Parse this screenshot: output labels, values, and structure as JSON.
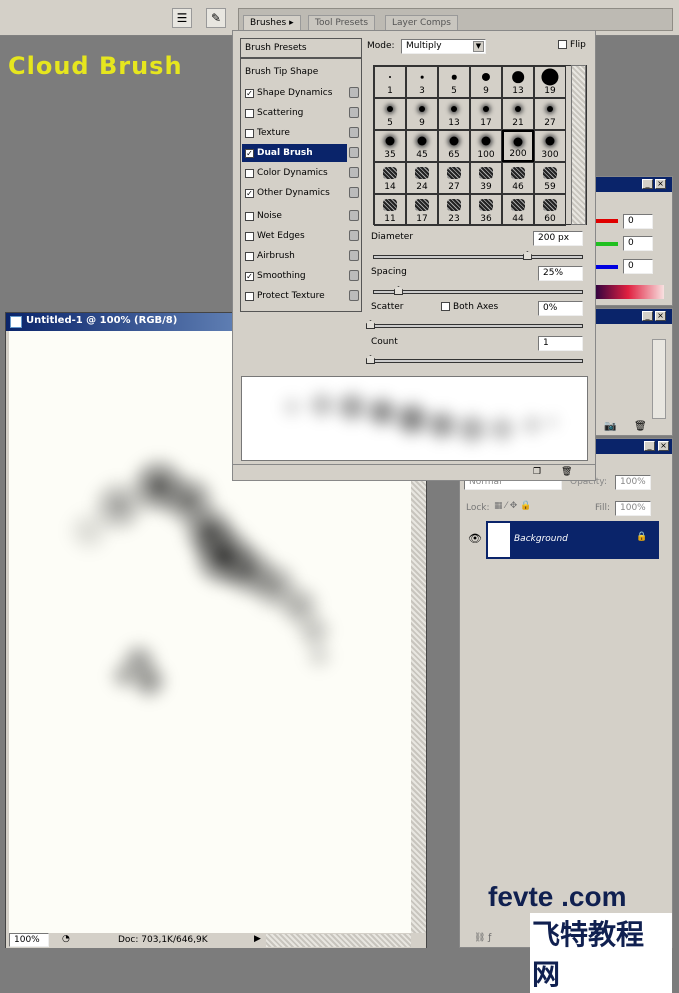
{
  "heading": "Cloud Brush",
  "tabs": [
    {
      "label": "Brushes"
    },
    {
      "label": "Tool Presets"
    },
    {
      "label": "Layer Comps"
    }
  ],
  "brushes": {
    "presets_label": "Brush Presets",
    "tip_shape_label": "Brush Tip Shape",
    "options": [
      {
        "label": "Shape Dynamics",
        "checked": true
      },
      {
        "label": "Scattering",
        "checked": false
      },
      {
        "label": "Texture",
        "checked": false
      },
      {
        "label": "Dual Brush",
        "checked": true,
        "selected": true
      },
      {
        "label": "Color Dynamics",
        "checked": false
      },
      {
        "label": "Other Dynamics",
        "checked": true
      },
      {
        "label": "Noise",
        "checked": false
      },
      {
        "label": "Wet Edges",
        "checked": false
      },
      {
        "label": "Airbrush",
        "checked": false
      },
      {
        "label": "Smoothing",
        "checked": true
      },
      {
        "label": "Protect Texture",
        "checked": false
      }
    ],
    "mode_label": "Mode:",
    "mode_value": "Multiply",
    "flip_label": "Flip",
    "tips": [
      "1",
      "3",
      "5",
      "9",
      "13",
      "19",
      "5",
      "9",
      "13",
      "17",
      "21",
      "27",
      "35",
      "45",
      "65",
      "100",
      "200",
      "300",
      "14",
      "24",
      "27",
      "39",
      "46",
      "59",
      "11",
      "17",
      "23",
      "36",
      "44",
      "60"
    ],
    "selected_tip": "200",
    "diameter_label": "Diameter",
    "diameter_value": "200 px",
    "diameter_pct": 74,
    "spacing_label": "Spacing",
    "spacing_value": "25%",
    "spacing_pct": 12,
    "scatter_label": "Scatter",
    "both_axes_label": "Both Axes",
    "scatter_value": "0%",
    "scatter_pct": 0,
    "count_label": "Count",
    "count_value": "1",
    "count_pct": 0
  },
  "document": {
    "title": "Untitled-1 @ 100% (RGB/8)",
    "zoom": "100%",
    "doc_info": "Doc: 703,1K/646,9K"
  },
  "color_panel": {
    "r": "0",
    "g": "0",
    "b": "0",
    "colors": {
      "r": "#e00000",
      "g": "#20c020",
      "b": "#0000e0"
    }
  },
  "layers": {
    "blend": "Normal",
    "opacity_label": "Opacity:",
    "opacity": "100%",
    "lock_label": "Lock:",
    "fill_label": "Fill:",
    "fill": "100%",
    "layer_name": "Background"
  },
  "watermark": {
    "line1": "fevte .com",
    "line2": "飞特教程网"
  }
}
